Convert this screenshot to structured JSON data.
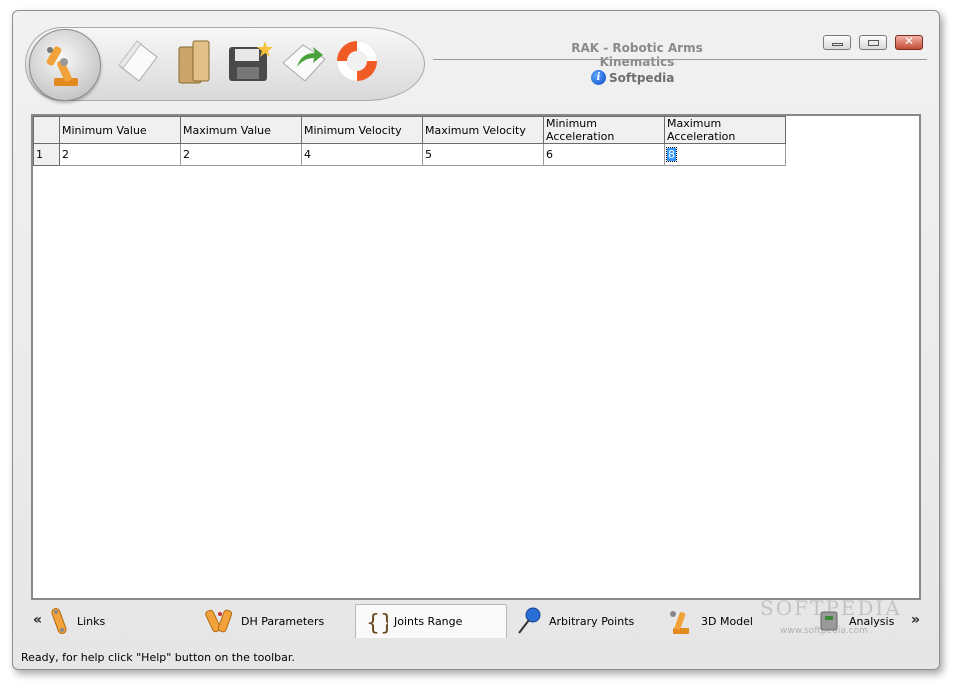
{
  "window": {
    "title": "RAK - Robotic Arms Kinematics",
    "brand": "Softpedia"
  },
  "toolbar": {
    "items": [
      {
        "icon": "robot-arm-icon"
      },
      {
        "icon": "new-document-icon"
      },
      {
        "icon": "open-folder-icon"
      },
      {
        "icon": "save-disk-icon"
      },
      {
        "icon": "export-icon"
      },
      {
        "icon": "help-lifebuoy-icon"
      }
    ]
  },
  "grid": {
    "columns": [
      "Minimum Value",
      "Maximum Value",
      "Minimum Velocity",
      "Maximum Velocity",
      "Minimum Acceleration",
      "Maximum Acceleration"
    ],
    "rows": [
      {
        "index": "1",
        "cells": [
          "2",
          "2",
          "4",
          "5",
          "6",
          "8"
        ]
      }
    ]
  },
  "tabs": [
    {
      "label": "Links",
      "icon": "link-icon"
    },
    {
      "label": "DH Parameters",
      "icon": "dh-parameters-icon"
    },
    {
      "label": "Joints Range",
      "icon": "braces-icon",
      "active": true
    },
    {
      "label": "Arbitrary Points",
      "icon": "pushpin-icon"
    },
    {
      "label": "3D Model",
      "icon": "robot-model-icon"
    },
    {
      "label": "Analysis",
      "icon": "analysis-icon"
    }
  ],
  "nav": {
    "prev": "«",
    "next": "»"
  },
  "status": "Ready, for help click \"Help\" button on the toolbar.",
  "watermark": {
    "text": "SOFTPEDIA",
    "url": "www.softpedia.com"
  },
  "colors": {
    "selection": "#3399ff",
    "accent_orange": "#f2a23a",
    "close_red": "#c44b36"
  }
}
